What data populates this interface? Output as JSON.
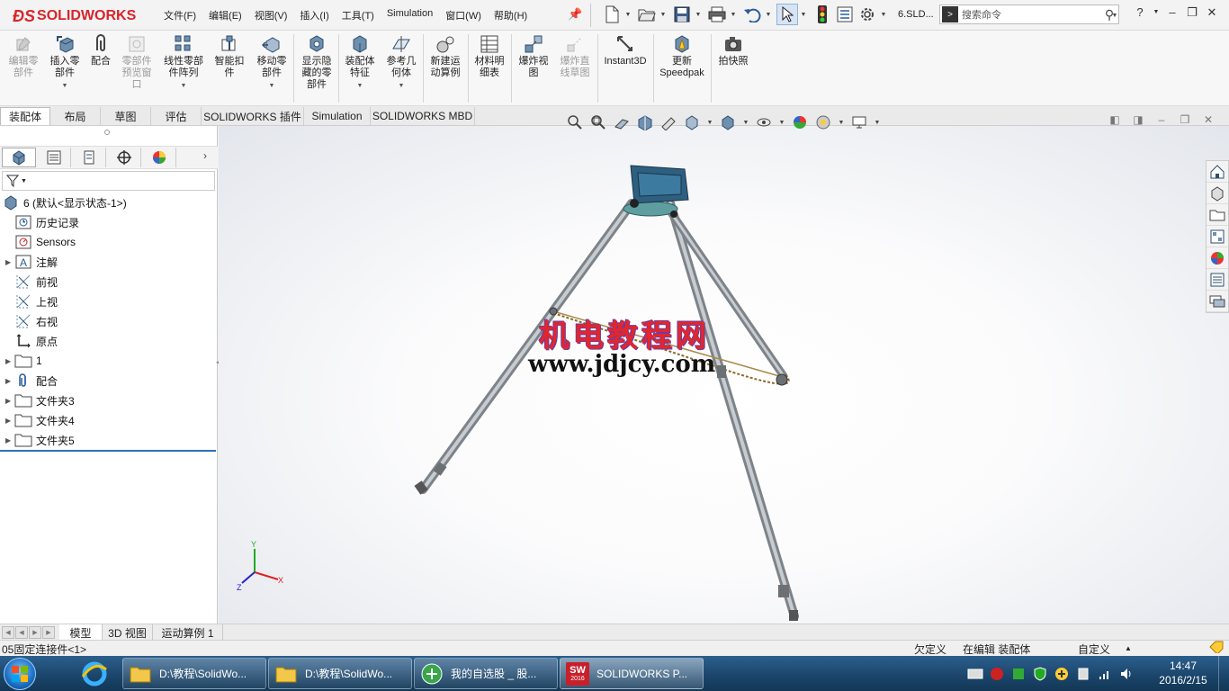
{
  "titlebar": {
    "logo": "SOLIDWORKS",
    "menu": [
      "文件(F)",
      "编辑(E)",
      "视图(V)",
      "插入(I)",
      "工具(T)",
      "Simulation",
      "窗口(W)",
      "帮助(H)"
    ],
    "doc_name": "6.SLD...",
    "search_placeholder": "搜索命令",
    "help": "?",
    "minimize": "–",
    "restore": "❐",
    "close": "✕"
  },
  "ribbon": {
    "buttons": [
      {
        "label": "编辑零\n部件",
        "disabled": true
      },
      {
        "label": "插入零\n部件",
        "disabled": false,
        "dropdown": true
      },
      {
        "label": "配合",
        "disabled": false
      },
      {
        "label": "零部件\n预览窗\n口",
        "disabled": true
      },
      {
        "label": "线性零部\n件阵列",
        "disabled": false,
        "dropdown": true
      },
      {
        "label": "智能扣\n件",
        "disabled": false
      },
      {
        "label": "移动零\n部件",
        "disabled": false,
        "dropdown": true
      },
      {
        "label": "显示隐\n藏的零\n部件",
        "disabled": false
      },
      {
        "label": "装配体\n特征",
        "disabled": false,
        "dropdown": true
      },
      {
        "label": "参考几\n何体",
        "disabled": false,
        "dropdown": true
      },
      {
        "label": "新建运\n动算例",
        "disabled": false
      },
      {
        "label": "材料明\n细表",
        "disabled": false
      },
      {
        "label": "爆炸视\n图",
        "disabled": false
      },
      {
        "label": "爆炸直\n线草图",
        "disabled": true
      },
      {
        "label": "Instant3D",
        "disabled": false
      },
      {
        "label": "更新\nSpeedpak",
        "disabled": false
      },
      {
        "label": "拍快照",
        "disabled": false
      }
    ]
  },
  "command_tabs": [
    "装配体",
    "布局",
    "草图",
    "评估",
    "SOLIDWORKS 插件",
    "Simulation",
    "SOLIDWORKS MBD"
  ],
  "feature_tree": {
    "root": "6  (默认<显示状态-1>)",
    "items": [
      {
        "label": "历史记录",
        "expandable": false,
        "icon": "history-icon"
      },
      {
        "label": "Sensors",
        "expandable": false,
        "icon": "sensors-icon"
      },
      {
        "label": "注解",
        "expandable": true,
        "icon": "annotation-icon"
      },
      {
        "label": "前视",
        "expandable": false,
        "icon": "plane-icon"
      },
      {
        "label": "上视",
        "expandable": false,
        "icon": "plane-icon"
      },
      {
        "label": "右视",
        "expandable": false,
        "icon": "plane-icon"
      },
      {
        "label": "原点",
        "expandable": false,
        "icon": "origin-icon"
      },
      {
        "label": "1",
        "expandable": true,
        "icon": "folder-icon"
      },
      {
        "label": "配合",
        "expandable": true,
        "icon": "mate-icon"
      },
      {
        "label": "文件夹3",
        "expandable": true,
        "icon": "folder-icon"
      },
      {
        "label": "文件夹4",
        "expandable": true,
        "icon": "folder-icon"
      },
      {
        "label": "文件夹5",
        "expandable": true,
        "icon": "folder-icon"
      }
    ]
  },
  "viewport": {
    "watermark_cn": "机电教程网",
    "watermark_url": "www.jdjcy.com",
    "triad_x": "X",
    "triad_y": "Y",
    "triad_z": "Z"
  },
  "bottom_tabs": [
    "模型",
    "3D 视图",
    "运动算例 1"
  ],
  "status": {
    "left": "05固定连接件<1>",
    "undefined": "欠定义",
    "editing": "在编辑 装配体",
    "custom": "自定义"
  },
  "taskbar": {
    "items": [
      "D:\\教程\\SolidWo...",
      "D:\\教程\\SolidWo...",
      "我的自选股 _ 股...",
      "SOLIDWORKS P..."
    ],
    "sw_badge": "2016",
    "time": "14:47",
    "date": "2016/2/15"
  },
  "colors": {
    "brand_red": "#d6252b",
    "taskbar": "#1a4469",
    "watermark_red": "#e3252d"
  }
}
